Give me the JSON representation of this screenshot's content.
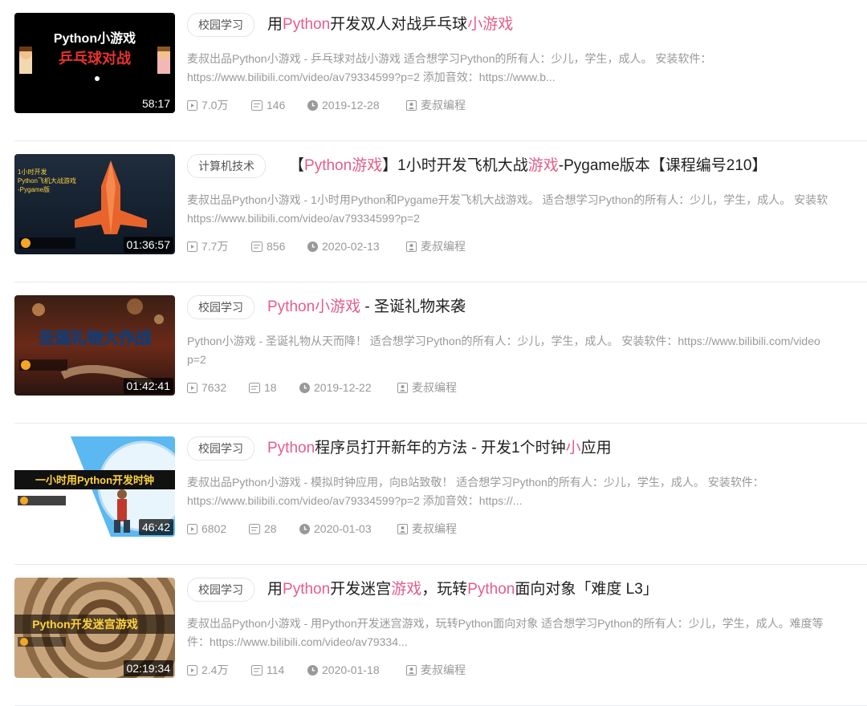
{
  "videos": [
    {
      "tag": "校园学习",
      "title": [
        {
          "t": "用"
        },
        {
          "t": "Python",
          "hl": true
        },
        {
          "t": "开发双人对战乒乓球"
        },
        {
          "t": "小游戏",
          "hl": true
        }
      ],
      "desc1": "麦叔出品Python小游戏 - 乒乓球对战小游戏 适合想学习Python的所有人：少儿，学生，成人。 安装软件：",
      "desc2": "https://www.bilibili.com/video/av79334599?p=2 添加音效：https://www.b...",
      "duration": "58:17",
      "plays": "7.0万",
      "danmaku": "146",
      "date": "2019-12-28",
      "author": "麦叔编程",
      "thumb_text": [
        "Python小游戏",
        "乒乓球对战"
      ]
    },
    {
      "tag": "计算机技术",
      "title": [
        {
          "t": "【"
        },
        {
          "t": "Python游戏",
          "hl": true
        },
        {
          "t": "】1小时开发飞机大战"
        },
        {
          "t": "游戏",
          "hl": true
        },
        {
          "t": "-Pygame版本【课程编号210】"
        }
      ],
      "desc1": "麦叔出品Python小游戏 - 1小时用Python和Pygame开发飞机大战游戏。 适合想学习Python的所有人：少儿，学生，成人。 安装软",
      "desc2": "https://www.bilibili.com/video/av79334599?p=2",
      "duration": "01:36:57",
      "plays": "7.7万",
      "danmaku": "856",
      "date": "2020-02-13",
      "author": "麦叔编程",
      "thumb_text": [
        "1小时开发",
        "Python飞机大战游戏",
        "-Pygame版"
      ]
    },
    {
      "tag": "校园学习",
      "title": [
        {
          "t": "Python小游戏",
          "hl": true
        },
        {
          "t": " - 圣诞礼物来袭"
        }
      ],
      "desc1": "Python小游戏 - 圣诞礼物从天而降！ 适合想学习Python的所有人：少儿，学生，成人。 安装软件：https://www.bilibili.com/video",
      "desc2": "p=2",
      "duration": "01:42:41",
      "plays": "7632",
      "danmaku": "18",
      "date": "2019-12-22",
      "author": "麦叔编程",
      "thumb_text": [
        "圣诞礼物大作战"
      ]
    },
    {
      "tag": "校园学习",
      "title": [
        {
          "t": "Python",
          "hl": true
        },
        {
          "t": "程序员打开新年的方法 - 开发1个时钟"
        },
        {
          "t": "小",
          "hl": true
        },
        {
          "t": "应用"
        }
      ],
      "desc1": "麦叔出品Python小游戏 - 模拟时钟应用，向B站致敬！ 适合想学习Python的所有人：少儿，学生，成人。 安装软件：",
      "desc2": "https://www.bilibili.com/video/av79334599?p=2 添加音效：https://...",
      "duration": "46:42",
      "plays": "6802",
      "danmaku": "28",
      "date": "2020-01-03",
      "author": "麦叔编程",
      "thumb_text": [
        "一小时用Python开发时钟"
      ]
    },
    {
      "tag": "校园学习",
      "title": [
        {
          "t": "用"
        },
        {
          "t": "Python",
          "hl": true
        },
        {
          "t": "开发迷宫"
        },
        {
          "t": "游戏",
          "hl": true
        },
        {
          "t": "，玩转"
        },
        {
          "t": "Python",
          "hl": true
        },
        {
          "t": "面向对象「难度 L3」"
        }
      ],
      "desc1": "麦叔出品Python小游戏 - 用Python开发迷宫游戏，玩转Python面向对象 适合想学习Python的所有人：少儿，学生，成人。难度等",
      "desc2": "件：https://www.bilibili.com/video/av79334...",
      "duration": "02:19:34",
      "plays": "2.4万",
      "danmaku": "114",
      "date": "2020-01-18",
      "author": "麦叔编程",
      "thumb_text": [
        "Python开发迷宫游戏"
      ]
    }
  ]
}
